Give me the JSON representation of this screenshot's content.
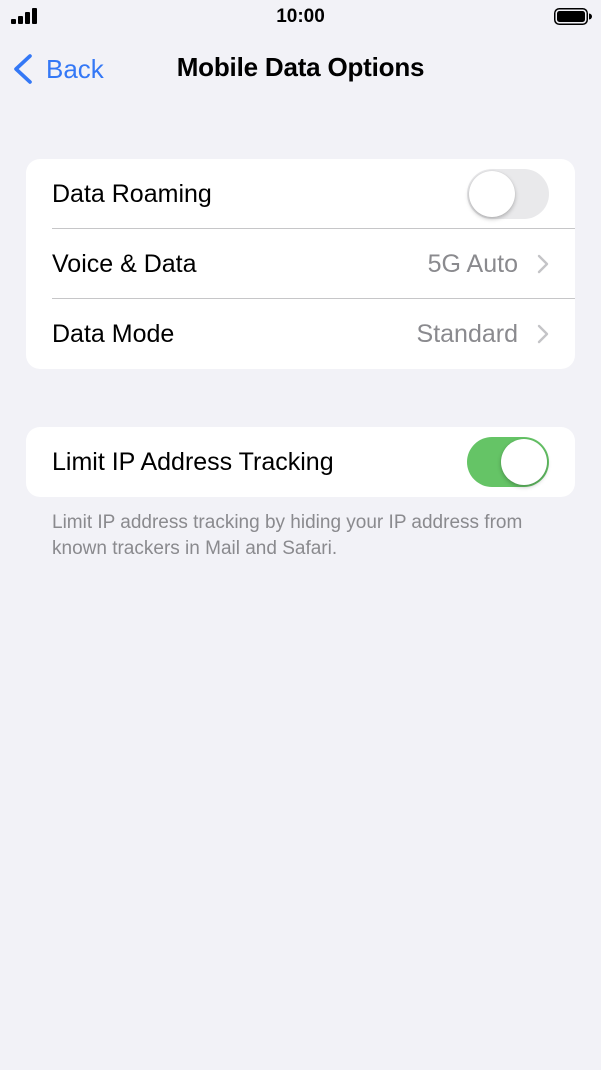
{
  "status_bar": {
    "time": "10:00"
  },
  "nav": {
    "back_label": "Back",
    "title": "Mobile Data Options"
  },
  "group1": {
    "rows": [
      {
        "label": "Data Roaming",
        "control": "toggle",
        "on": false
      },
      {
        "label": "Voice & Data",
        "value": "5G Auto"
      },
      {
        "label": "Data Mode",
        "value": "Standard"
      }
    ]
  },
  "group2": {
    "rows": [
      {
        "label": "Limit IP Address Tracking",
        "control": "toggle",
        "on": true
      }
    ],
    "footer": "Limit IP address tracking by hiding your IP address from known trackers in Mail and Safari."
  },
  "colors": {
    "accent": "#3478f6",
    "toggle_on": "#65c466",
    "toggle_off": "#e9e9eb",
    "background": "#f2f2f7"
  },
  "icons": [
    "signal-icon",
    "battery-icon",
    "chevron-left-icon",
    "chevron-right-icon"
  ]
}
